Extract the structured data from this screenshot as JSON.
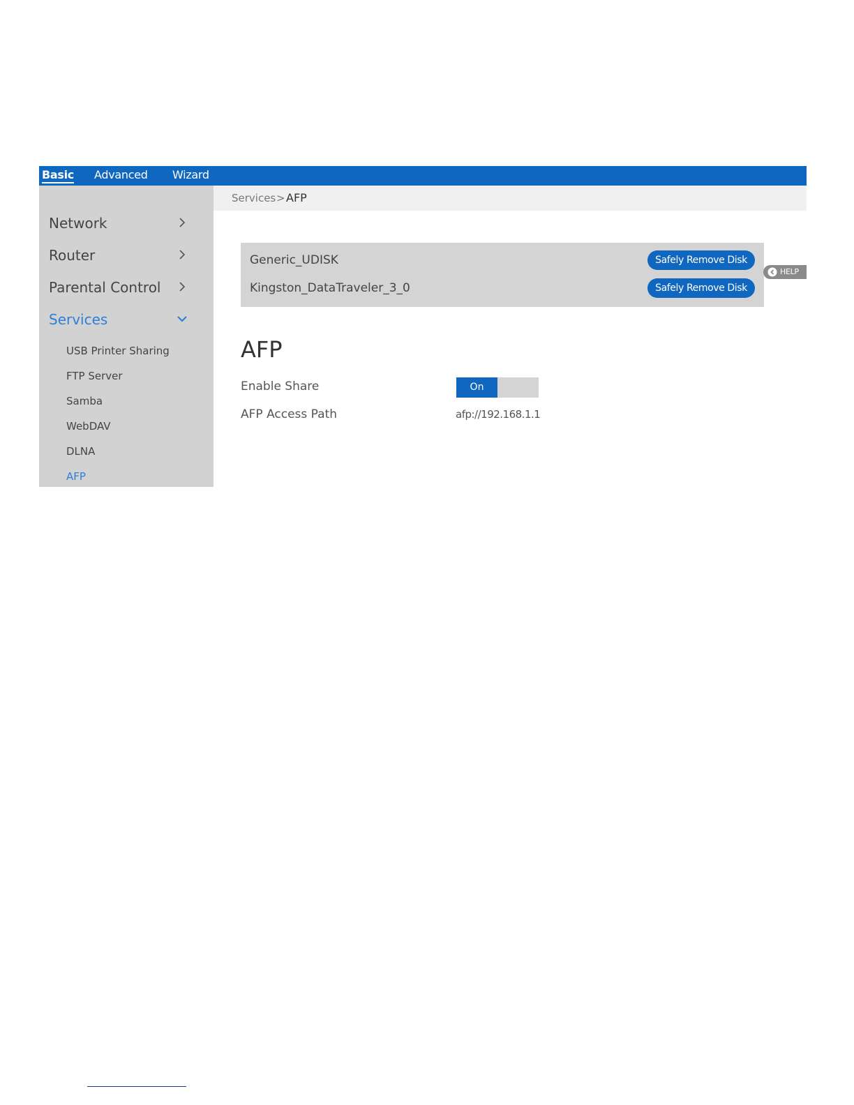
{
  "topnav": {
    "tabs": [
      {
        "label": "Basic",
        "active": true
      },
      {
        "label": "Advanced",
        "active": false
      },
      {
        "label": "Wizard",
        "active": false
      }
    ]
  },
  "sidebar": {
    "items": [
      {
        "label": "Network",
        "icon": "chevron-right-icon"
      },
      {
        "label": "Router",
        "icon": "chevron-right-icon"
      },
      {
        "label": "Parental Control",
        "icon": "chevron-right-icon"
      },
      {
        "label": "Services",
        "icon": "chevron-down-icon",
        "expanded": true
      }
    ],
    "subitems": [
      {
        "label": "USB Printer Sharing"
      },
      {
        "label": "FTP Server"
      },
      {
        "label": "Samba"
      },
      {
        "label": "WebDAV"
      },
      {
        "label": "DLNA"
      },
      {
        "label": "AFP",
        "active": true
      }
    ]
  },
  "breadcrumb": {
    "parent": "Services",
    "separator": ">",
    "current": "AFP"
  },
  "disks": [
    {
      "name": "Generic_UDISK",
      "button": "Safely Remove Disk"
    },
    {
      "name": "Kingston_DataTraveler_3_0",
      "button": "Safely Remove Disk"
    }
  ],
  "help": {
    "label": "HELP",
    "icon": "chevron-left-circle-icon"
  },
  "afp": {
    "title": "AFP",
    "enable_label": "Enable Share",
    "toggle_state": "On",
    "path_label": "AFP Access Path",
    "path_value": "afp://192.168.1.1"
  },
  "colors": {
    "accent": "#0f67bf",
    "link_active": "#2f7ed8",
    "sidebar_bg": "#d2d2d2",
    "panel_bg": "#d4d4d4"
  }
}
